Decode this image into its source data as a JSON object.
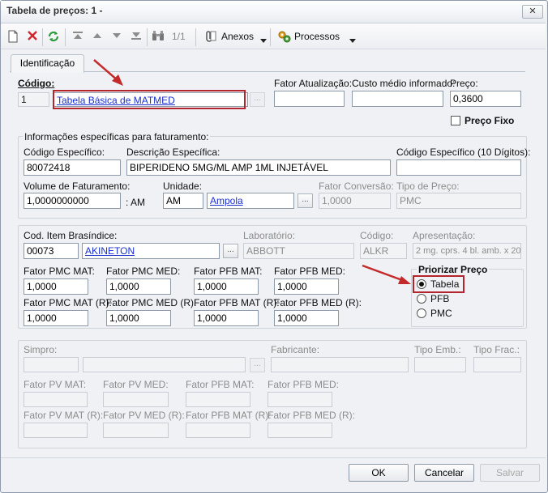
{
  "window": {
    "title": "Tabela de preços: 1 -",
    "close_label": "✕"
  },
  "toolbar": {
    "nav_position": "1/1",
    "anexos_label": "Anexos",
    "processos_label": "Processos"
  },
  "tabs": [
    {
      "label": "Identificação"
    }
  ],
  "header": {
    "codigo_label": "Código:",
    "codigo_value": "1",
    "tabela_link": "Tabela Básica de MATMED",
    "fator_atualizacao_label": "Fator Atualização:",
    "custo_medio_label": "Custo médio informado:",
    "preco_label": "Preço:",
    "preco_value": "0,3600",
    "preco_fixo_label": "Preço Fixo",
    "preco_fixo_checked": false
  },
  "faturamento": {
    "group_label": "Informações específicas para faturamento:",
    "codigo_especifico_label": "Código Específico:",
    "codigo_especifico_value": "80072418",
    "descricao_label": "Descrição Específica:",
    "descricao_value": "BIPERIDENO 5MG/ML AMP 1ML INJETÁVEL",
    "codigo10_label": "Código Específico (10 Dígitos):",
    "volume_label": "Volume de Faturamento:",
    "volume_value": "1,0000000000",
    "volume_unit": ": AM",
    "unidade_label": "Unidade:",
    "unidade_value": "AM",
    "unidade_link": "Ampola",
    "fator_conversao_label": "Fator Conversão:",
    "fator_conversao_value": "1,0000",
    "tipo_preco_label": "Tipo de Preço:",
    "tipo_preco_value": "PMC"
  },
  "brasindice": {
    "cod_item_label": "Cod. Item Brasíndice:",
    "cod_item_value": "00073",
    "cod_item_link": "AKINETON",
    "laboratorio_label": "Laboratório:",
    "laboratorio_value": "ABBOTT",
    "codigo_label": "Código:",
    "codigo_value": "ALKR",
    "apresentacao_label": "Apresentação:",
    "apresentacao_value": "2 mg. cprs. 4 bl. amb. x 20",
    "fields": [
      {
        "label": "Fator PMC MAT:",
        "value": "1,0000"
      },
      {
        "label": "Fator PMC MED:",
        "value": "1,0000"
      },
      {
        "label": "Fator PFB MAT:",
        "value": "1,0000"
      },
      {
        "label": "Fator PFB MED:",
        "value": "1,0000"
      },
      {
        "label": "Fator PMC MAT (R):",
        "value": "1,0000"
      },
      {
        "label": "Fator PMC MED (R):",
        "value": "1,0000"
      },
      {
        "label": "Fator PFB MAT (R):",
        "value": "1,0000"
      },
      {
        "label": "Fator PFB MED (R):",
        "value": "1,0000"
      }
    ],
    "priorizar_label": "Priorizar Preço",
    "priorizar_options": [
      "Tabela",
      "PFB",
      "PMC"
    ],
    "priorizar_selected": "Tabela"
  },
  "simpro": {
    "simpro_label": "Simpro:",
    "fabricante_label": "Fabricante:",
    "tipo_emb_label": "Tipo Emb.:",
    "tipo_frac_label": "Tipo Frac.:",
    "fields": [
      {
        "label": "Fator PV MAT:"
      },
      {
        "label": "Fator PV MED:"
      },
      {
        "label": "Fator PFB MAT:"
      },
      {
        "label": "Fator PFB MED:"
      },
      {
        "label": "Fator PV MAT (R):"
      },
      {
        "label": "Fator PV MED (R):"
      },
      {
        "label": "Fator PFB MAT (R):"
      },
      {
        "label": "Fator PFB MED (R):"
      }
    ]
  },
  "footer": {
    "ok_label": "OK",
    "cancel_label": "Cancelar",
    "save_label": "Salvar"
  },
  "colors": {
    "highlight_box": "#b3242c",
    "arrow": "#c42a2a",
    "link": "#1a2fcf"
  }
}
